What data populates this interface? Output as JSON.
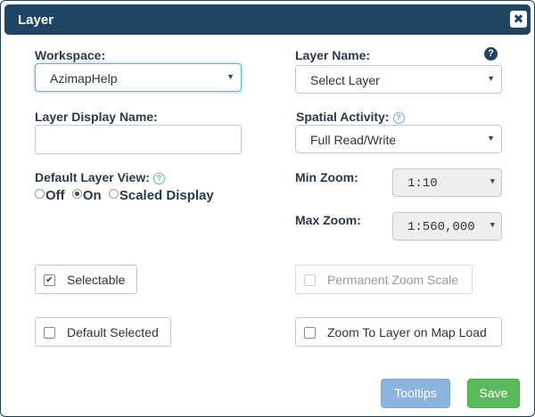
{
  "dialog": {
    "title": "Layer",
    "close_glyph": "✖",
    "close_icon": "close-icon"
  },
  "workspace": {
    "label": "Workspace:",
    "value": "AzimapHelp"
  },
  "layer_name": {
    "label": "Layer Name:",
    "value": "Select Layer",
    "help_icon": "help-icon"
  },
  "layer_display_name": {
    "label": "Layer Display Name:",
    "value": ""
  },
  "spatial_activity": {
    "label": "Spatial Activity:",
    "value": "Full Read/Write",
    "help_icon": "help-icon"
  },
  "default_layer_view": {
    "label": "Default Layer View:",
    "options": [
      "Off",
      "On",
      "Scaled Display"
    ],
    "selected": "On",
    "help_icon": "help-icon"
  },
  "min_zoom": {
    "label": "Min Zoom:",
    "value": "1:10"
  },
  "max_zoom": {
    "label": "Max Zoom:",
    "value": "1:560,000"
  },
  "checkboxes": {
    "selectable": {
      "label": "Selectable",
      "checked": true
    },
    "default_selected": {
      "label": "Default Selected",
      "checked": false
    },
    "permanent_zoom_scale": {
      "label": "Permanent Zoom Scale",
      "checked": false,
      "disabled": true
    },
    "zoom_to_layer": {
      "label": "Zoom To Layer on Map Load",
      "checked": false
    }
  },
  "buttons": {
    "tooltips": "Tooltips",
    "save": "Save"
  },
  "glyphs": {
    "caret": "▼",
    "check": "✔",
    "help": "?"
  },
  "colors": {
    "title_bar": "#1f4563",
    "tooltips_button": "#8cb4dc",
    "save_button": "#5cb85c",
    "label_text": "#2b3a4a"
  }
}
